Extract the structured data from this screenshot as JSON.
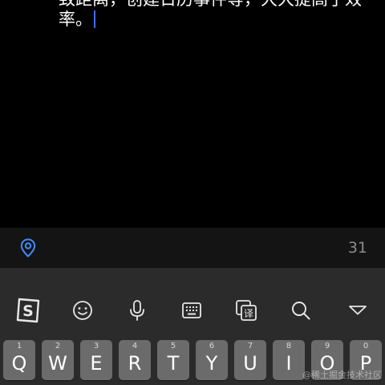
{
  "editor": {
    "line1": "致距离，创建日历事件等，大大提高了效",
    "line2": "率。"
  },
  "info_bar": {
    "location_icon": "location-pin-icon",
    "char_count": "31"
  },
  "keyboard": {
    "toolbar": [
      {
        "id": "sogou-logo",
        "icon": "sogou-s-icon",
        "label": "S"
      },
      {
        "id": "emoji",
        "icon": "smiley-icon"
      },
      {
        "id": "voice",
        "icon": "microphone-icon"
      },
      {
        "id": "keyboard-layout",
        "icon": "keyboard-icon"
      },
      {
        "id": "translate",
        "icon": "translate-icon",
        "label": "译"
      },
      {
        "id": "search",
        "icon": "search-icon"
      },
      {
        "id": "collapse",
        "icon": "chevron-down-icon"
      }
    ],
    "keys": [
      {
        "main": "Q",
        "sub": "1"
      },
      {
        "main": "W",
        "sub": "2"
      },
      {
        "main": "E",
        "sub": "3"
      },
      {
        "main": "R",
        "sub": "4"
      },
      {
        "main": "T",
        "sub": "5"
      },
      {
        "main": "Y",
        "sub": "6"
      },
      {
        "main": "U",
        "sub": "7"
      },
      {
        "main": "I",
        "sub": "8"
      },
      {
        "main": "O",
        "sub": "9"
      },
      {
        "main": "P",
        "sub": "0"
      }
    ]
  },
  "watermark": "@稀土掘金技术社区",
  "colors": {
    "background": "#000000",
    "caret": "#3d6cff",
    "location_icon": "#3f8cff",
    "key": "#6b6b6b",
    "keyboard_bg": "#2b2b2b"
  }
}
